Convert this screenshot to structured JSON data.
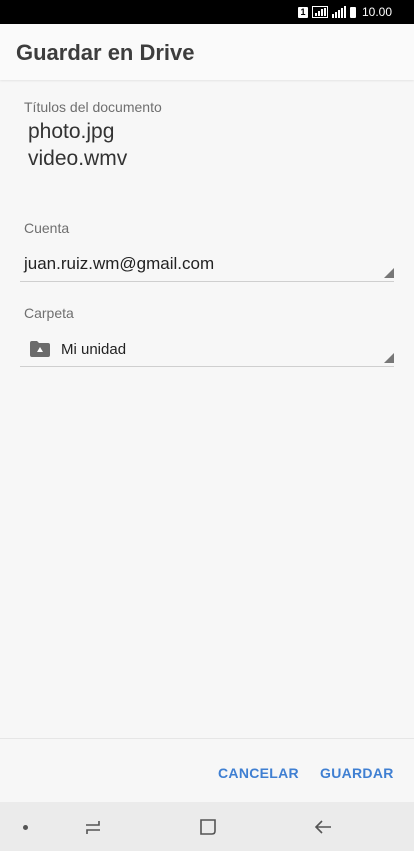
{
  "status_bar": {
    "sim_label": "1",
    "time": "10.00"
  },
  "header": {
    "title": "Guardar en Drive"
  },
  "documents": {
    "label": "Títulos del documento",
    "names": [
      "photo.jpg",
      "video.wmv"
    ]
  },
  "account": {
    "label": "Cuenta",
    "value": "juan.ruiz.wm@gmail.com"
  },
  "folder": {
    "label": "Carpeta",
    "value": "Mi unidad"
  },
  "actions": {
    "cancel_label": "CANCELAR",
    "save_label": "GUARDAR"
  },
  "colors": {
    "accent": "#3f7fd2",
    "header_text": "#3d3d3d"
  }
}
